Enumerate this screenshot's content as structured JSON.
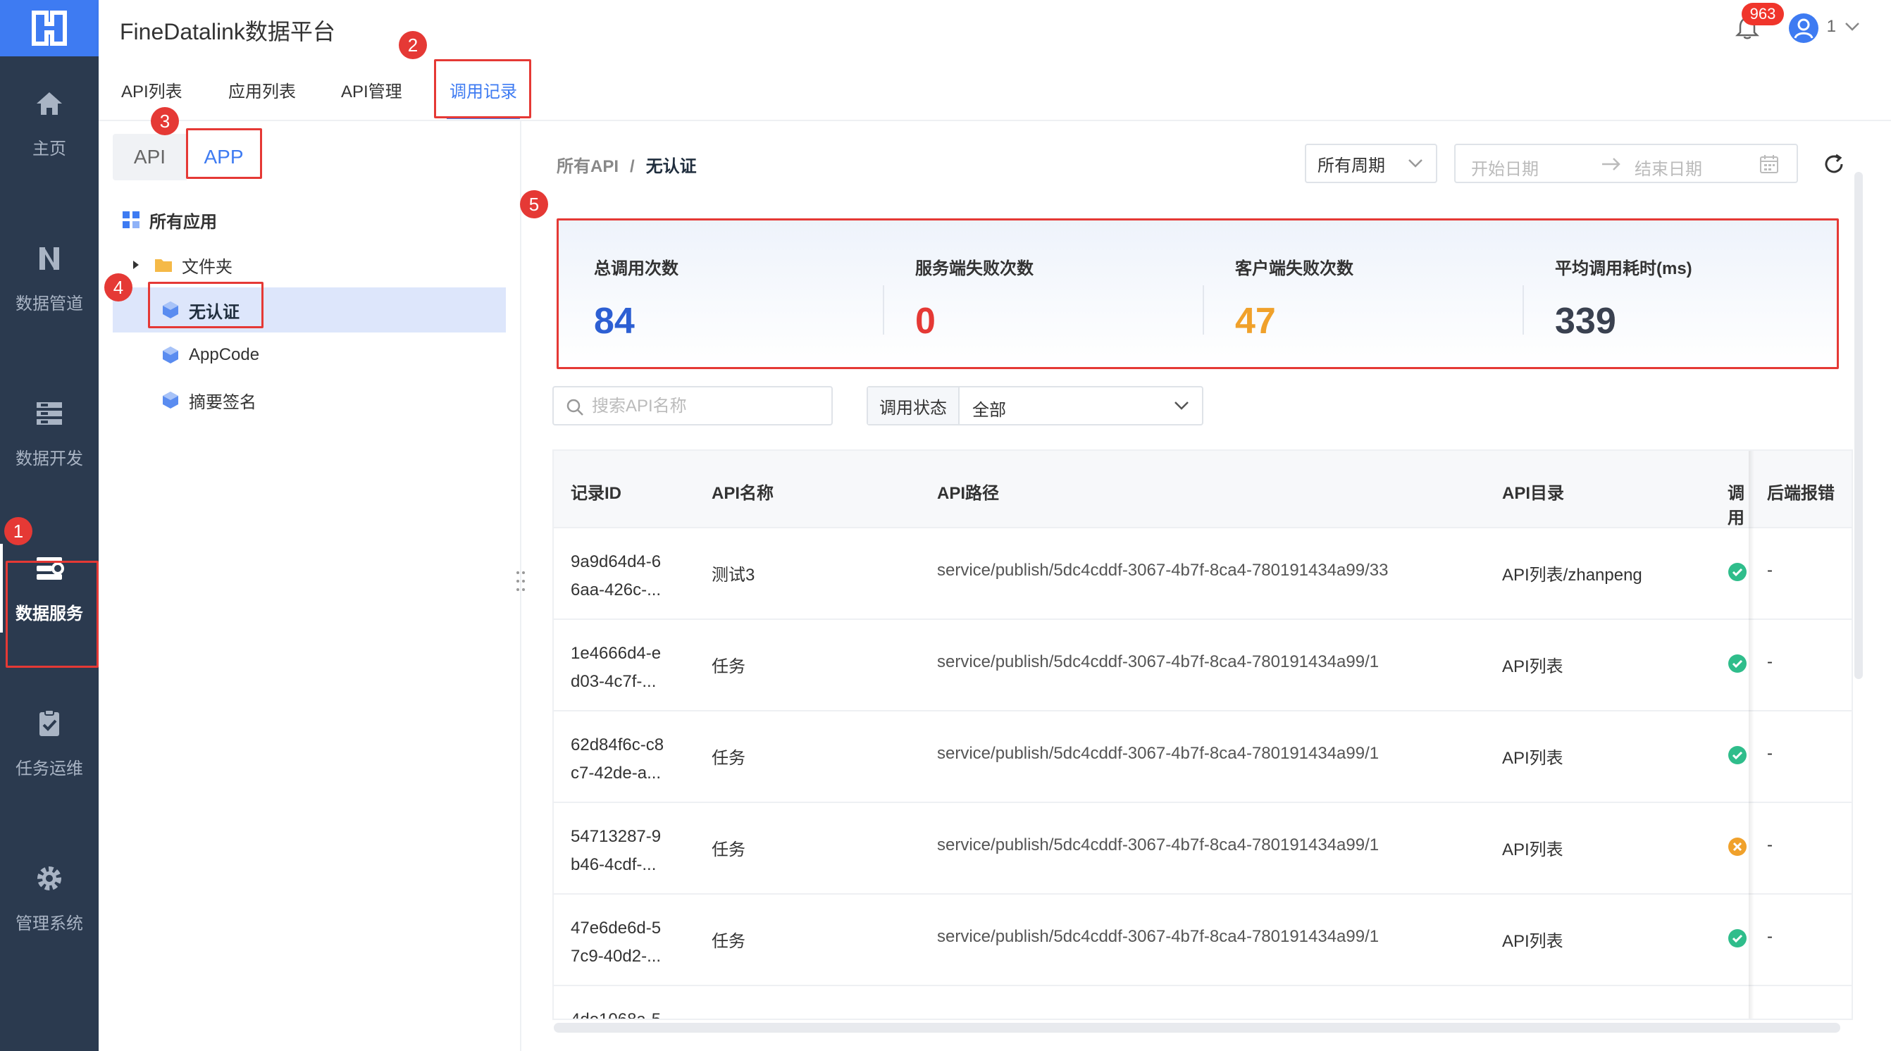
{
  "app": {
    "title": "FineDatalink数据平台"
  },
  "header": {
    "notification_count": "963",
    "user_name": "1"
  },
  "nav": {
    "items": [
      {
        "label": "主页",
        "icon": "home-icon"
      },
      {
        "label": "数据管道",
        "icon": "pipeline-icon"
      },
      {
        "label": "数据开发",
        "icon": "database-icon"
      },
      {
        "label": "数据服务",
        "icon": "data-service-icon",
        "active": true
      },
      {
        "label": "任务运维",
        "icon": "clipboard-check-icon"
      },
      {
        "label": "管理系统",
        "icon": "gear-icon"
      }
    ]
  },
  "tabs": [
    {
      "label": "API列表"
    },
    {
      "label": "应用列表"
    },
    {
      "label": "API管理"
    },
    {
      "label": "调用记录",
      "active": true
    }
  ],
  "segment": {
    "api": "API",
    "app": "APP",
    "active": "APP"
  },
  "tree": {
    "root": "所有应用",
    "folder": "文件夹",
    "items": [
      "无认证",
      "AppCode",
      "摘要签名"
    ],
    "selected": "无认证"
  },
  "breadcrumb": {
    "root": "所有API",
    "sep": "/",
    "current": "无认证"
  },
  "filters": {
    "period": "所有周期",
    "start_placeholder": "开始日期",
    "end_placeholder": "结束日期",
    "search_placeholder": "搜索API名称",
    "status_label": "调用状态",
    "status_value": "全部"
  },
  "stats": [
    {
      "label": "总调用次数",
      "value": "84",
      "color": "#2d5fd3"
    },
    {
      "label": "服务端失败次数",
      "value": "0",
      "color": "#e53935"
    },
    {
      "label": "客户端失败次数",
      "value": "47",
      "color": "#f0a12b"
    },
    {
      "label": "平均调用耗时(ms)",
      "value": "339",
      "color": "#3a4150"
    }
  ],
  "table": {
    "columns": {
      "id": "记录ID",
      "name": "API名称",
      "path": "API路径",
      "dir": "API目录",
      "status": "调用状态",
      "error": "后端报错"
    },
    "rows": [
      {
        "id": "9a9d64d4-6 6aa-426c-...",
        "name": "测试3",
        "path": "service/publish/5dc4cddf-3067-4b7f-8ca4-780191434a99/33",
        "dir": "API列表/zhanpeng",
        "status": "success",
        "error": "-"
      },
      {
        "id": "1e4666d4-e d03-4c7f-...",
        "name": "任务",
        "path": "service/publish/5dc4cddf-3067-4b7f-8ca4-780191434a99/1",
        "dir": "API列表",
        "status": "success",
        "error": "-"
      },
      {
        "id": "62d84f6c-c8 c7-42de-a...",
        "name": "任务",
        "path": "service/publish/5dc4cddf-3067-4b7f-8ca4-780191434a99/1",
        "dir": "API列表",
        "status": "success",
        "error": "-"
      },
      {
        "id": "54713287-9 b46-4cdf-...",
        "name": "任务",
        "path": "service/publish/5dc4cddf-3067-4b7f-8ca4-780191434a99/1",
        "dir": "API列表",
        "status": "failed",
        "error": "-"
      },
      {
        "id": "47e6de6d-5 7c9-40d2-...",
        "name": "任务",
        "path": "service/publish/5dc4cddf-3067-4b7f-8ca4-780191434a99/1",
        "dir": "API列表",
        "status": "success",
        "error": "-"
      },
      {
        "id": "4de1068a-5",
        "name": "",
        "path": "",
        "dir": "",
        "status": "",
        "error": ""
      }
    ]
  },
  "annotations": [
    "1",
    "2",
    "3",
    "4",
    "5"
  ],
  "colors": {
    "accent": "#3e7bf2",
    "rail": "#2b3a4f",
    "highlight": "#e53935",
    "success": "#2fbd8b",
    "warn": "#f0a12b"
  }
}
